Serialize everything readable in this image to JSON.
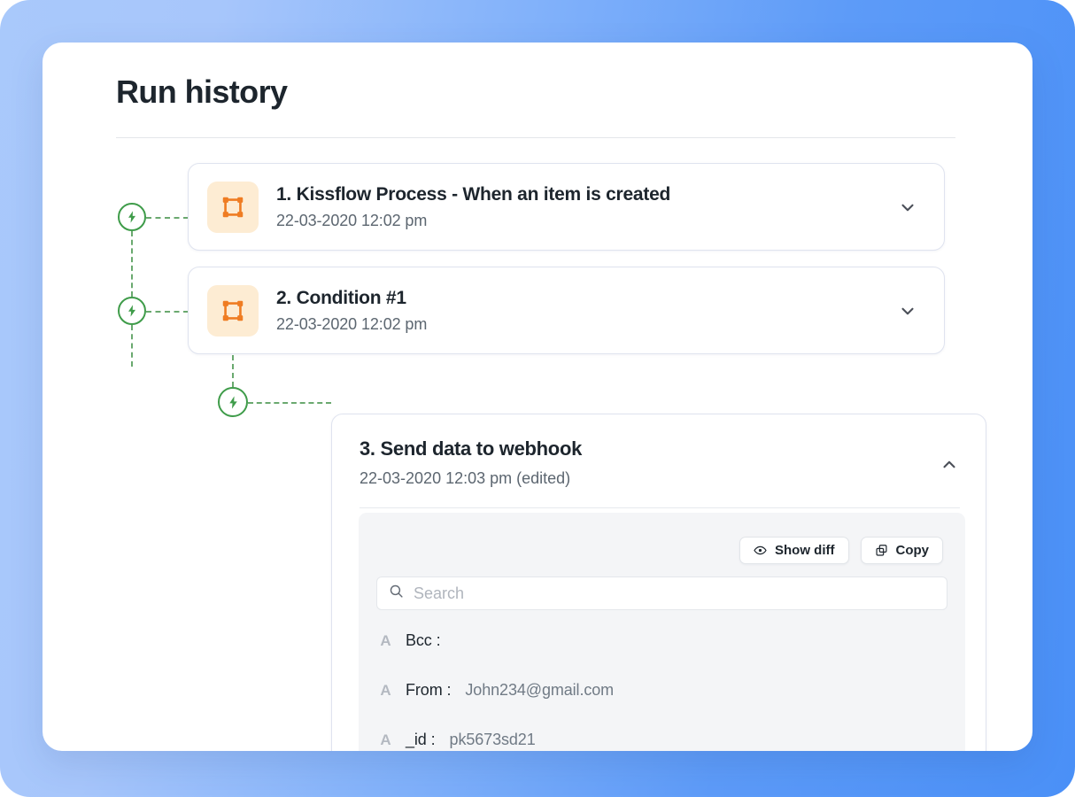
{
  "page": {
    "title": "Run history"
  },
  "steps": [
    {
      "name": "1. Kissflow Process - When an item is created",
      "time": "22-03-2020  12:02 pm",
      "icon": "artboard-icon",
      "chevron": "chevron-down-icon",
      "expanded": false
    },
    {
      "name": "2. Condition #1",
      "time": "22-03-2020  12:02 pm",
      "icon": "artboard-icon",
      "chevron": "chevron-down-icon",
      "expanded": false
    },
    {
      "name": "3. Send data to webhook",
      "time": "22-03-2020  12:03 pm (edited)",
      "chevron": "chevron-up-icon",
      "expanded": true
    }
  ],
  "panel": {
    "buttons": [
      {
        "label": "Show diff",
        "icon": "eye-icon"
      },
      {
        "label": "Copy",
        "icon": "copy-icon"
      }
    ],
    "search": {
      "placeholder": "Search",
      "value": "",
      "icon": "search-icon"
    },
    "fields": [
      {
        "type_tag": "A",
        "key": "Bcc :",
        "value": ""
      },
      {
        "type_tag": "A",
        "key": "From :",
        "value": "John234@gmail.com"
      },
      {
        "type_tag": "A",
        "key": "_id :",
        "value": "pk5673sd21"
      }
    ]
  },
  "timeline": {
    "badge_icon": "lightning-bolt-icon",
    "badge_color": "#3f9c4a",
    "connector_color": "#6aa96f"
  },
  "colors": {
    "accent_orange": "#ef7c22",
    "icon_bg": "#fdecd3",
    "background_blue_start": "#a9c9fb",
    "background_blue_end": "#4a90f7",
    "text_primary": "#1d252d",
    "text_secondary": "#5c6670"
  }
}
